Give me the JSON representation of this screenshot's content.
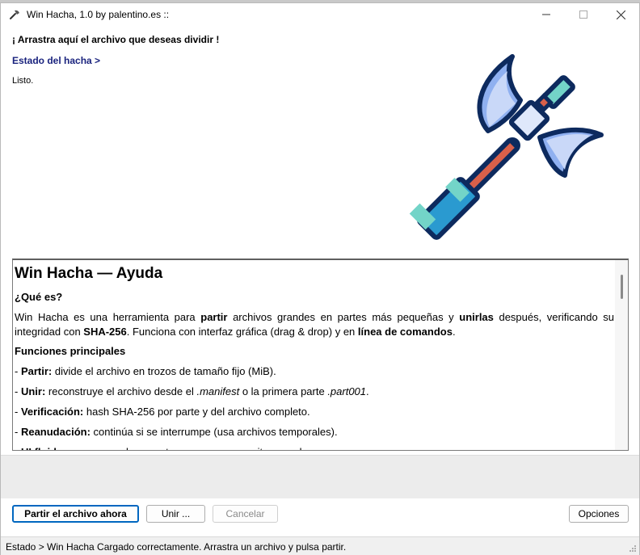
{
  "window": {
    "title": "Win Hacha, 1.0 by palentino.es ::",
    "app_icon": "axe-icon"
  },
  "top": {
    "drop_label": "¡ Arrastra aquí el archivo que deseas dividir !",
    "state_link": "Estado del hacha >",
    "status": "Listo."
  },
  "help": {
    "title": "Win Hacha — Ayuda",
    "what_heading": "¿Qué es?",
    "intro": [
      {
        "t": "Win Hacha es una herramienta para ",
        "b": false,
        "i": false
      },
      {
        "t": "partir",
        "b": true,
        "i": false
      },
      {
        "t": " archivos grandes en partes más pequeñas y ",
        "b": false,
        "i": false
      },
      {
        "t": "unirlas",
        "b": true,
        "i": false
      },
      {
        "t": " después, verificando su integridad con ",
        "b": false,
        "i": false
      },
      {
        "t": "SHA-256",
        "b": true,
        "i": false
      },
      {
        "t": ". Funciona con interfaz gráfica (drag & drop) y en ",
        "b": false,
        "i": false
      },
      {
        "t": "línea de comandos",
        "b": true,
        "i": false
      },
      {
        "t": ".",
        "b": false,
        "i": false
      }
    ],
    "features_heading": "Funciones principales",
    "features": [
      [
        {
          "t": "- ",
          "b": false,
          "i": false
        },
        {
          "t": "Partir:",
          "b": true,
          "i": false
        },
        {
          "t": " divide el archivo en trozos de tamaño fijo (MiB).",
          "b": false,
          "i": false
        }
      ],
      [
        {
          "t": "- ",
          "b": false,
          "i": false
        },
        {
          "t": "Unir:",
          "b": true,
          "i": false
        },
        {
          "t": " reconstruye el archivo desde el ",
          "b": false,
          "i": false
        },
        {
          "t": ".manifest",
          "b": false,
          "i": true
        },
        {
          "t": " o la primera parte ",
          "b": false,
          "i": false
        },
        {
          "t": ".part001",
          "b": false,
          "i": true
        },
        {
          "t": ".",
          "b": false,
          "i": false
        }
      ],
      [
        {
          "t": "- ",
          "b": false,
          "i": false
        },
        {
          "t": "Verificación:",
          "b": true,
          "i": false
        },
        {
          "t": " hash SHA-256 por parte y del archivo completo.",
          "b": false,
          "i": false
        }
      ],
      [
        {
          "t": "- ",
          "b": false,
          "i": false
        },
        {
          "t": "Reanudación:",
          "b": true,
          "i": false
        },
        {
          "t": " continúa si se interrumpe (usa archivos temporales).",
          "b": false,
          "i": false
        }
      ],
      [
        {
          "t": "- ",
          "b": false,
          "i": false
        },
        {
          "t": "UI fluida:",
          "b": true,
          "i": false
        },
        {
          "t": " no se congela; muestra progreso y permite cancelar.",
          "b": false,
          "i": false
        }
      ]
    ]
  },
  "buttons": {
    "split": "Partir el archivo ahora",
    "join": "Unir ...",
    "cancel": "Cancelar",
    "options": "Opciones"
  },
  "statusbar": {
    "text": "Estado > Win Hacha Cargado correctamente. Arrastra un archivo y pulsa partir."
  },
  "colors": {
    "accent": "#0067c0",
    "link": "#1a237e",
    "axe_outline": "#0d2a5e",
    "axe_blade": "#8fb0f0",
    "axe_handle_grip": "#2a9ad0",
    "axe_handle_shaft": "#d9604a"
  }
}
